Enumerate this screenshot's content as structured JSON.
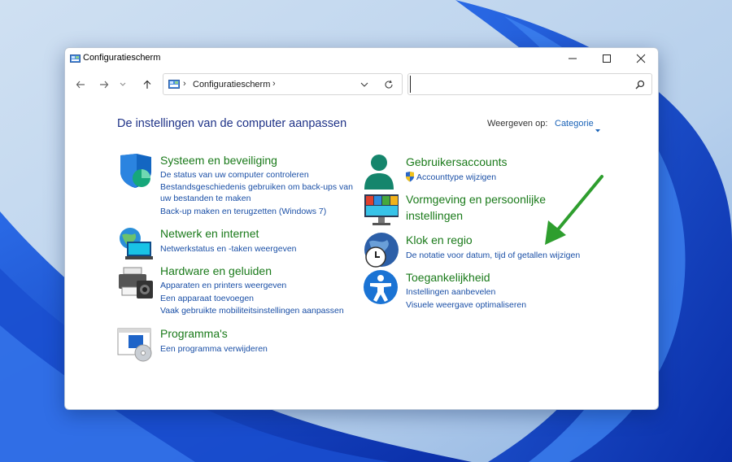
{
  "window": {
    "title": "Configuratiescherm"
  },
  "address": {
    "path": "Configuratiescherm"
  },
  "search": {
    "placeholder": "",
    "value": ""
  },
  "page": {
    "title": "De instellingen van de computer aanpassen",
    "view_label": "Weergeven op:",
    "view_value": "Categorie"
  },
  "categories": [
    {
      "title": "Systeem en beveiliging",
      "links": [
        "De status van uw computer controleren",
        "Bestandsgeschiedenis gebruiken om back-ups van",
        "uw bestanden te maken",
        "Back-up maken en terugzetten (Windows 7)"
      ]
    },
    {
      "title": "Netwerk en internet",
      "links": [
        "Netwerkstatus en -taken weergeven"
      ]
    },
    {
      "title": "Hardware en geluiden",
      "links": [
        "Apparaten en printers weergeven",
        "Een apparaat toevoegen",
        "Vaak gebruikte mobiliteitsinstellingen aanpassen"
      ]
    },
    {
      "title": "Programma's",
      "links": [
        "Een programma verwijderen"
      ]
    },
    {
      "title": "Gebruikersaccounts",
      "links": [
        "Accounttype wijzigen"
      ]
    },
    {
      "title": "Vormgeving en persoonlijke",
      "title2": "instellingen",
      "links": []
    },
    {
      "title": "Klok en regio",
      "links": [
        "De notatie voor datum, tijd of getallen wijzigen"
      ]
    },
    {
      "title": "Toegankelijkheid",
      "links": [
        "Instellingen aanbevelen",
        "Visuele weergave optimaliseren"
      ]
    }
  ],
  "colors": {
    "accent": "#1a63b8",
    "category_title": "#1a7a1a",
    "link": "#1a4fa6",
    "annotation_arrow": "#2e9e2e"
  }
}
